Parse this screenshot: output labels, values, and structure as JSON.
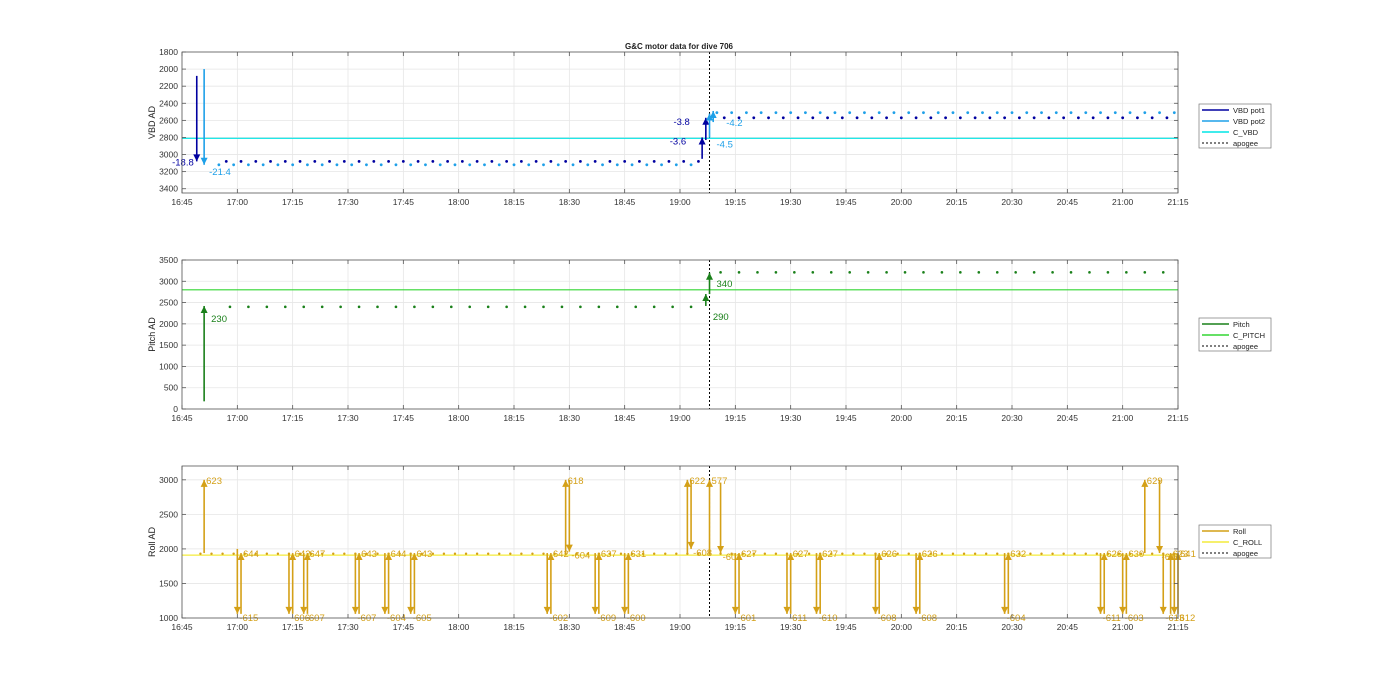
{
  "figure": {
    "title": "G&C motor data for dive 706"
  },
  "x_ticks": [
    "16:45",
    "17:00",
    "17:15",
    "17:30",
    "17:45",
    "18:00",
    "18:15",
    "18:30",
    "18:45",
    "19:00",
    "19:15",
    "19:30",
    "19:45",
    "20:00",
    "20:15",
    "20:30",
    "20:45",
    "21:00",
    "21:15"
  ],
  "colors": {
    "vbd_pot1": "#0000a0",
    "vbd_pot2": "#1ea0e8",
    "c_vbd": "#00e5e5",
    "pitch": "#1a801a",
    "c_pitch": "#33d633",
    "roll": "#d4a017",
    "c_roll": "#f4ec3c",
    "apogee": "#000000"
  },
  "chart_data": [
    {
      "type": "scatter",
      "ylabel": "VBD AD",
      "ylim": [
        1800,
        3450
      ],
      "y_reversed": true,
      "yticks": [
        "1800",
        "2000",
        "2200",
        "2400",
        "2600",
        "2800",
        "3000",
        "3200",
        "3400"
      ],
      "grid": true,
      "legend_position": "right",
      "legend": [
        "VBD pot1",
        "VBD pot2",
        "C_VBD",
        "apogee"
      ],
      "c_vbd_value": 2810,
      "apogee_time": "19:08",
      "x_range": [
        "16:45",
        "21:15"
      ],
      "pot1_first": {
        "start": "16:49",
        "value": 3080,
        "from": 2080
      },
      "pot2_first": {
        "start": "16:51",
        "value": 3120,
        "from": 2000
      },
      "pot1_segments": [
        {
          "start": "16:55",
          "end": "19:05",
          "value": 3080
        },
        {
          "start": "19:10",
          "end": "21:15",
          "value": 2570
        }
      ],
      "pot2_segments": [
        {
          "start": "16:55",
          "end": "19:05",
          "value": 3120
        },
        {
          "start": "19:10",
          "end": "21:15",
          "value": 2510
        }
      ],
      "arrows": [
        {
          "series": "pot1",
          "time": "16:49",
          "from": 2080,
          "to": 3080,
          "label": "-18.8"
        },
        {
          "series": "pot2",
          "time": "16:51",
          "from": 2000,
          "to": 3120,
          "label": "-21.4"
        },
        {
          "series": "pot1",
          "time": "19:06",
          "from": 3050,
          "to": 2800,
          "label": "-3.6"
        },
        {
          "series": "pot1",
          "time": "19:07",
          "from": 2830,
          "to": 2570,
          "label": "-3.8"
        },
        {
          "series": "pot2",
          "time": "19:08",
          "from": 2800,
          "to": 2520,
          "label": "-4.5"
        },
        {
          "series": "pot2",
          "time": "19:09",
          "from": 2620,
          "to": 2490,
          "label": "-4.2"
        }
      ]
    },
    {
      "type": "scatter",
      "ylabel": "Pitch AD",
      "ylim": [
        0,
        3500
      ],
      "yticks": [
        "0",
        "500",
        "1000",
        "1500",
        "2000",
        "2500",
        "3000",
        "3500"
      ],
      "grid": true,
      "legend_position": "right",
      "legend": [
        "Pitch",
        "C_PITCH",
        "apogee"
      ],
      "c_pitch_value": 2800,
      "apogee_time": "19:08",
      "pitch_segments": [
        {
          "start": "16:58",
          "end": "19:05",
          "value": 2400
        },
        {
          "start": "19:11",
          "end": "21:15",
          "value": 3210
        }
      ],
      "arrows": [
        {
          "time": "16:51",
          "from": 180,
          "to": 2420,
          "label": "230"
        },
        {
          "time": "19:07",
          "from": 2420,
          "to": 2700,
          "label": "290"
        },
        {
          "time": "19:08",
          "from": 2700,
          "to": 3200,
          "label": "340"
        }
      ]
    },
    {
      "type": "scatter",
      "ylabel": "Roll AD",
      "ylim": [
        1000,
        3200
      ],
      "yticks": [
        "1000",
        "1500",
        "2000",
        "2500",
        "3000"
      ],
      "grid": true,
      "legend_position": "right",
      "legend": [
        "Roll",
        "C_ROLL",
        "apogee"
      ],
      "c_roll_value": 1910,
      "apogee_time": "19:08",
      "arrows": [
        {
          "time": "16:51",
          "from": 1940,
          "to": 3000,
          "label": "623"
        },
        {
          "time": "17:00",
          "from": 2000,
          "to": 1060,
          "label": "-615"
        },
        {
          "time": "17:01",
          "from": 1060,
          "to": 1940,
          "label": "644"
        },
        {
          "time": "17:14",
          "from": 1940,
          "to": 1060,
          "label": "-606"
        },
        {
          "time": "17:15",
          "from": 1060,
          "to": 1940,
          "label": "642"
        },
        {
          "time": "17:18",
          "from": 1940,
          "to": 1060,
          "label": "-607"
        },
        {
          "time": "17:19",
          "from": 1060,
          "to": 1940,
          "label": "647"
        },
        {
          "time": "17:32",
          "from": 1940,
          "to": 1060,
          "label": "-607"
        },
        {
          "time": "17:33",
          "from": 1060,
          "to": 1940,
          "label": "643"
        },
        {
          "time": "17:40",
          "from": 1940,
          "to": 1060,
          "label": "-604"
        },
        {
          "time": "17:41",
          "from": 1060,
          "to": 1940,
          "label": "644"
        },
        {
          "time": "17:47",
          "from": 1940,
          "to": 1060,
          "label": "-605"
        },
        {
          "time": "17:48",
          "from": 1060,
          "to": 1940,
          "label": "643"
        },
        {
          "time": "18:24",
          "from": 1940,
          "to": 1060,
          "label": "-602"
        },
        {
          "time": "18:25",
          "from": 1060,
          "to": 1940,
          "label": "642"
        },
        {
          "time": "18:29",
          "from": 1940,
          "to": 3000,
          "label": "618"
        },
        {
          "time": "18:30",
          "from": 3000,
          "to": 1960,
          "label": "-604"
        },
        {
          "time": "18:37",
          "from": 1940,
          "to": 1060,
          "label": "-609"
        },
        {
          "time": "18:38",
          "from": 1060,
          "to": 1940,
          "label": "637"
        },
        {
          "time": "18:45",
          "from": 1940,
          "to": 1060,
          "label": "-600"
        },
        {
          "time": "18:46",
          "from": 1060,
          "to": 1940,
          "label": "631"
        },
        {
          "time": "19:02",
          "from": 1940,
          "to": 3000,
          "label": "622"
        },
        {
          "time": "19:03",
          "from": 3000,
          "to": 2000,
          "label": "-608"
        },
        {
          "time": "19:08",
          "from": 1940,
          "to": 3000,
          "label": "577"
        },
        {
          "time": "19:11",
          "from": 2960,
          "to": 1940,
          "label": "-601"
        },
        {
          "time": "19:15",
          "from": 1940,
          "to": 1060,
          "label": "-601"
        },
        {
          "time": "19:16",
          "from": 1060,
          "to": 1940,
          "label": "627"
        },
        {
          "time": "19:29",
          "from": 1940,
          "to": 1060,
          "label": "-611"
        },
        {
          "time": "19:30",
          "from": 1060,
          "to": 1940,
          "label": "627"
        },
        {
          "time": "19:37",
          "from": 1940,
          "to": 1060,
          "label": "-610"
        },
        {
          "time": "19:38",
          "from": 1060,
          "to": 1940,
          "label": "627"
        },
        {
          "time": "19:53",
          "from": 1940,
          "to": 1060,
          "label": "-608"
        },
        {
          "time": "19:54",
          "from": 1060,
          "to": 1940,
          "label": "626"
        },
        {
          "time": "20:04",
          "from": 1940,
          "to": 1060,
          "label": "-608"
        },
        {
          "time": "20:05",
          "from": 1060,
          "to": 1940,
          "label": "626"
        },
        {
          "time": "20:28",
          "from": 1940,
          "to": 1060,
          "label": "-604"
        },
        {
          "time": "20:29",
          "from": 1060,
          "to": 1940,
          "label": "632"
        },
        {
          "time": "20:54",
          "from": 1940,
          "to": 1060,
          "label": "-611"
        },
        {
          "time": "20:55",
          "from": 1060,
          "to": 1940,
          "label": "626"
        },
        {
          "time": "21:00",
          "from": 1940,
          "to": 1060,
          "label": "-603"
        },
        {
          "time": "21:01",
          "from": 1060,
          "to": 1940,
          "label": "630"
        },
        {
          "time": "21:06",
          "from": 1940,
          "to": 3000,
          "label": "629"
        },
        {
          "time": "21:10",
          "from": 3000,
          "to": 1940,
          "label": "-611"
        },
        {
          "time": "21:11",
          "from": 1940,
          "to": 1060,
          "label": "-613"
        },
        {
          "time": "21:13",
          "from": 1060,
          "to": 1940,
          "label": "623"
        },
        {
          "time": "21:14",
          "from": 1940,
          "to": 1060,
          "label": "-612"
        },
        {
          "time": "21:15",
          "from": 1060,
          "to": 1940,
          "label": "641"
        }
      ]
    }
  ]
}
